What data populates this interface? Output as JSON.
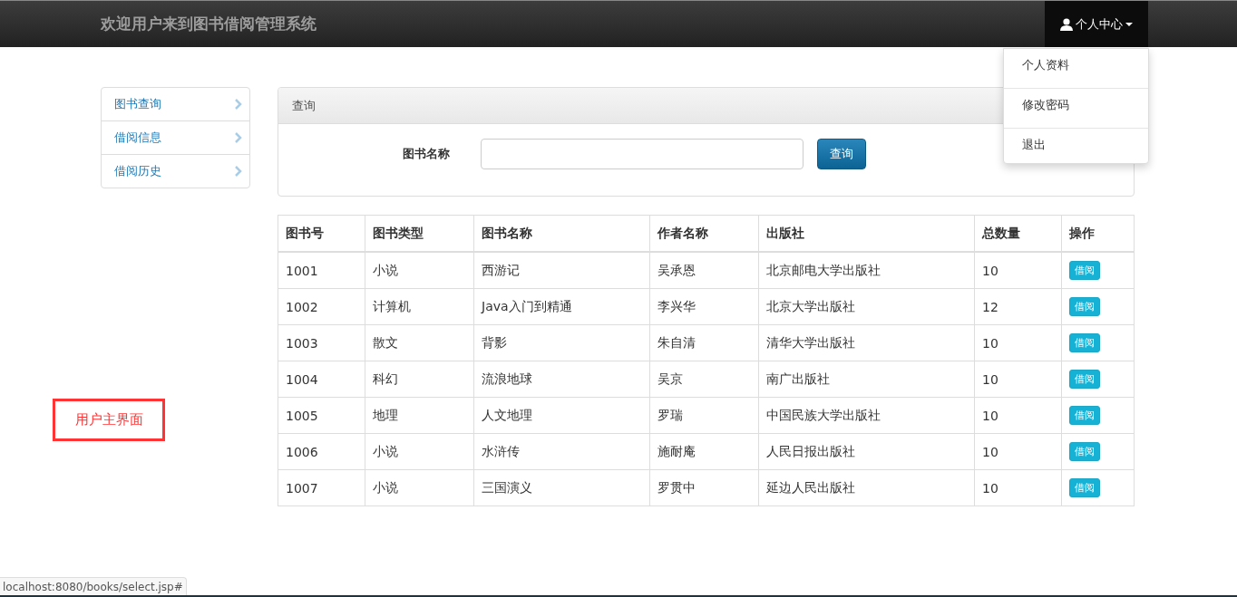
{
  "navbar": {
    "brand": "欢迎用户来到图书借阅管理系统",
    "user_menu": {
      "label": "个人中心",
      "expanded": true,
      "items": [
        "个人资料",
        "修改密码",
        "退出"
      ]
    }
  },
  "sidebar": {
    "items": [
      {
        "label": "图书查询"
      },
      {
        "label": "借阅信息"
      },
      {
        "label": "借阅历史"
      }
    ]
  },
  "query_panel": {
    "title": "查询",
    "field_label": "图书名称",
    "search_button": "查询"
  },
  "table": {
    "columns": [
      "图书号",
      "图书类型",
      "图书名称",
      "作者名称",
      "出版社",
      "总数量",
      "操作"
    ],
    "rows": [
      {
        "cells": [
          "1001",
          "小说",
          "西游记",
          "吴承恩",
          "北京邮电大学出版社",
          "10"
        ],
        "action": "借阅"
      },
      {
        "cells": [
          "1002",
          "计算机",
          "Java入门到精通",
          "李兴华",
          "北京大学出版社",
          "12"
        ],
        "action": "借阅"
      },
      {
        "cells": [
          "1003",
          "散文",
          "背影",
          "朱自清",
          "清华大学出版社",
          "10"
        ],
        "action": "借阅"
      },
      {
        "cells": [
          "1004",
          "科幻",
          "流浪地球",
          "吴京",
          "南广出版社",
          "10"
        ],
        "action": "借阅"
      },
      {
        "cells": [
          "1005",
          "地理",
          "人文地理",
          "罗瑞",
          "中国民族大学出版社",
          "10"
        ],
        "action": "借阅"
      },
      {
        "cells": [
          "1006",
          "小说",
          "水浒传",
          "施耐庵",
          "人民日报出版社",
          "10"
        ],
        "action": "借阅"
      },
      {
        "cells": [
          "1007",
          "小说",
          "三国演义",
          "罗贯中",
          "延边人民出版社",
          "10"
        ],
        "action": "借阅"
      }
    ]
  },
  "annotation": "用户主界面",
  "status_bar": {
    "url": "localhost:8080/books/select.jsp#"
  }
}
